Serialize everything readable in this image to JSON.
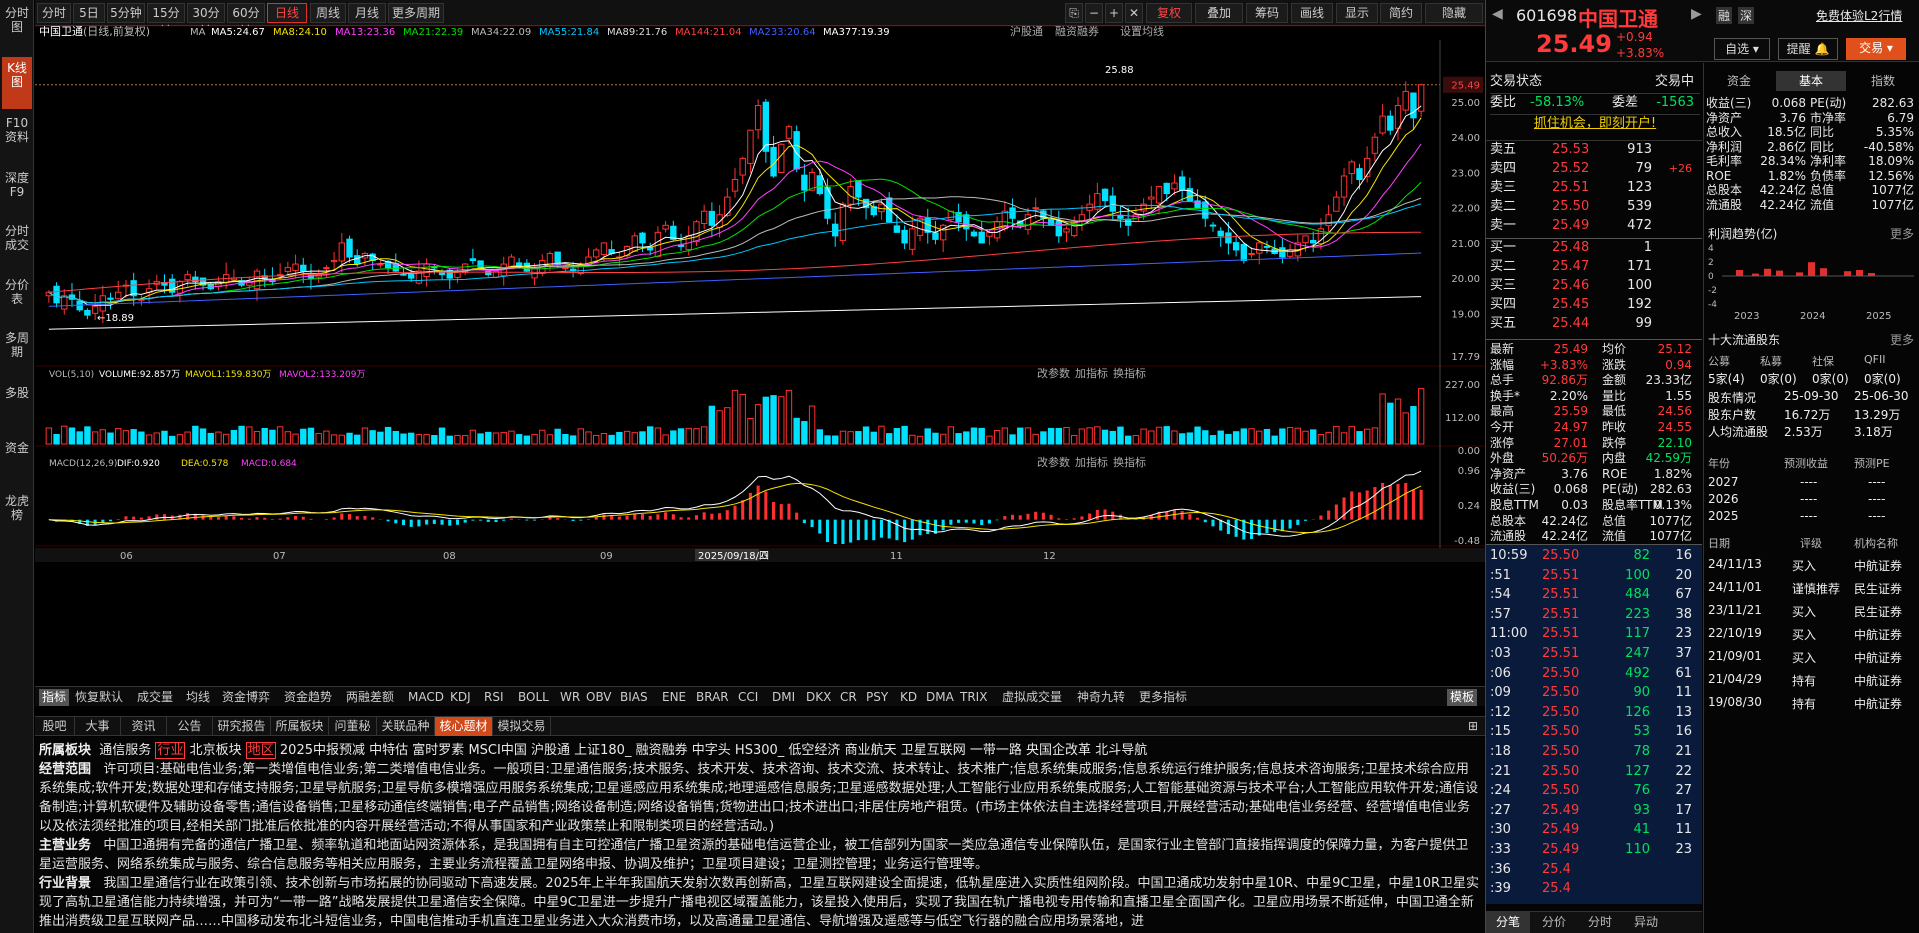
{
  "sidebar": [
    "分时图",
    "K线图",
    "F10资料",
    "深度F9",
    "分时成交",
    "分价表",
    "多周期",
    "多股",
    "资金",
    "龙虎榜"
  ],
  "toolbar": {
    "periods": [
      "分时",
      "5日",
      "5分钟",
      "15分钟",
      "30分钟",
      "60分钟",
      "日线",
      "周线",
      "月线",
      "更多周期"
    ],
    "right": [
      "复权",
      "叠加",
      "筹码",
      "画线",
      "显示",
      "简约",
      "隐藏"
    ]
  },
  "title": {
    "name": "中国卫通",
    "mode": "(日线,前复权)",
    "ma": "MA",
    "ma_items": [
      {
        "t": "MA5:24.67",
        "c": "#ffffff"
      },
      {
        "t": "MA8:24.10",
        "c": "#f5e400"
      },
      {
        "t": "MA13:23.36",
        "c": "#ff40ff"
      },
      {
        "t": "MA21:22.39",
        "c": "#00e000"
      },
      {
        "t": "MA34:22.09",
        "c": "#bbbbbb"
      },
      {
        "t": "MA55:21.84",
        "c": "#00c8ff"
      },
      {
        "t": "MA89:21.76",
        "c": "#dddddd"
      },
      {
        "t": "MA144:21.04",
        "c": "#ff4040"
      },
      {
        "t": "MA233:20.64",
        "c": "#4060ff"
      },
      {
        "t": "MA377:19.39",
        "c": "#ffffff"
      }
    ],
    "links": [
      "沪股通",
      "融资融券",
      "设置均线"
    ]
  },
  "price_axis": [
    "25.49",
    "25.00",
    "24.00",
    "23.00",
    "22.00",
    "21.00",
    "20.00",
    "19.00",
    "17.79"
  ],
  "annot": {
    "high": "25.88",
    "low": "18.89"
  },
  "vol": {
    "title": "VOL(5,10)",
    "v": "VOLUME:92.857万",
    "m1": "MAVOL1:159.830万",
    "m2": "MAVOL2:133.209万",
    "axis": [
      "227.00",
      "112.00",
      "0.00"
    ],
    "links": [
      "改参数",
      "加指标",
      "换指标"
    ]
  },
  "macd": {
    "title": "MACD(12,26,9)",
    "dif": "DIF:0.920",
    "dea": "DEA:0.578",
    "macd": "MACD:0.684",
    "axis": [
      "0.96",
      "0.24",
      "-0.48"
    ],
    "links": [
      "改参数",
      "加指标",
      "换指标"
    ]
  },
  "xaxis": [
    "06",
    "07",
    "08",
    "09",
    "10",
    "11",
    "12"
  ],
  "cursor_date": "2025/09/18/四",
  "indicators": [
    "指标",
    "恢复默认",
    "成交量",
    "均线",
    "资金博弈",
    "资金趋势",
    "两融差额",
    "MACD",
    "KDJ",
    "RSI",
    "BOLL",
    "WR",
    "OBV",
    "BIAS",
    "ENE",
    "BRAR",
    "CCI",
    "DMI",
    "DKX",
    "CR",
    "PSY",
    "KD",
    "DMA",
    "TRIX",
    "虚拟成交量",
    "神奇九转",
    "更多指标",
    "模板"
  ],
  "btabs": [
    "股吧",
    "大事",
    "资讯",
    "公告",
    "研究报告",
    "所属板块",
    "问董秘",
    "关联品种",
    "核心题材",
    "模拟交易"
  ],
  "info": {
    "bk_label": "所属板块",
    "bk": [
      "通信服务",
      "行业",
      "北京板块",
      "地区",
      "2025中报预减",
      "中特估",
      "富时罗素",
      "MSCI中国",
      "沪股通",
      "上证180_",
      "融资融券",
      "中字头",
      "HS300_",
      "低空经济",
      "商业航天",
      "卫星互联网",
      "一带一路",
      "央国企改革",
      "北斗导航"
    ],
    "scope_label": "经营范围",
    "scope": "许可项目:基础电信业务;第一类增值电信业务;第二类增值电信业务。一般项目:卫星通信服务;技术服务、技术开发、技术咨询、技术交流、技术转让、技术推广;信息系统集成服务;信息系统运行维护服务;信息技术咨询服务;卫星技术综合应用系统集成;软件开发;数据处理和存储支持服务;卫星导航服务;卫星导航多模增强应用服务系统集成;卫星遥感应用系统集成;地理遥感信息服务;卫星遥感数据处理;人工智能行业应用系统集成服务;人工智能基础资源与技术平台;人工智能应用软件开发;通信设备制造;计算机软硬件及辅助设备零售;通信设备销售;卫星移动通信终端销售;电子产品销售;网络设备制造;网络设备销售;货物进出口;技术进出口;非居住房地产租赁。(市场主体依法自主选择经营项目,开展经营活动;基础电信业务经营、经营增值电信业务以及依法须经批准的项目,经相关部门批准后依批准的内容开展经营活动;不得从事国家和产业政策禁止和限制类项目的经营活动。)",
    "main_label": "主营业务",
    "main": "中国卫通拥有完备的通信广播卫星、频率轨道和地面站网资源体系，是我国拥有自主可控通信广播卫星资源的基础电信运营企业，被工信部列为国家一类应急通信专业保障队伍，是国家行业主管部门直接指挥调度的保障力量，为客户提供卫星运营服务、网络系统集成与服务、综合信息服务等相关应用服务，主要业务流程覆盖卫星网络申报、协调及维护；卫星项目建设；卫星测控管理；业务运行管理等。",
    "bg_label": "行业背景",
    "bg": "我国卫星通信行业在政策引领、技术创新与市场拓展的协同驱动下高速发展。2025年上半年我国航天发射次数再创新高，卫星互联网建设全面提速，低轨星座进入实质性组网阶段。中国卫通成功发射中星10R、中星9C卫星，中星10R卫星实现了高轨卫星通信能力持续增强，并可为“一带一路”战略发展提供卫星通信安全保障。中星9C卫星进一步提升广播电视区域覆盖能力，该星投入使用后，实现了我国在轨广播电视专用传输和直播卫星全面国产化。卫星应用场景不断延伸，中国卫通全新推出消费级卫星互联网产品……中国移动发布北斗短信业务，中国电信推动手机直连卫星业务进入大众消费市场，以及高通量卫星通信、导航增强及遥感等与低空飞行器的融合应用场景落地，进"
  },
  "rp": {
    "code": "601698",
    "name": "中国卫通",
    "badges": [
      "融",
      "深"
    ],
    "free": "免费体验L2行情",
    "price": "25.49",
    "chg": "+0.94",
    "pct": "+3.83%",
    "btn1": "自选",
    "btn2": "提醒",
    "btn3": "交易",
    "status": "交易状态",
    "status_val": "交易中",
    "wb": "委比",
    "wb_v": "-58.13%",
    "wc": "委差",
    "wc_v": "-1563",
    "promo": "抓住机会，即刻开户!",
    "asks": [
      {
        "l": "卖五",
        "p": "25.53",
        "v": "913",
        "x": ""
      },
      {
        "l": "卖四",
        "p": "25.52",
        "v": "79",
        "x": "+26"
      },
      {
        "l": "卖三",
        "p": "25.51",
        "v": "123",
        "x": ""
      },
      {
        "l": "卖二",
        "p": "25.50",
        "v": "539",
        "x": ""
      },
      {
        "l": "卖一",
        "p": "25.49",
        "v": "472",
        "x": ""
      }
    ],
    "bids": [
      {
        "l": "买一",
        "p": "25.48",
        "v": "1"
      },
      {
        "l": "买二",
        "p": "25.47",
        "v": "171"
      },
      {
        "l": "买三",
        "p": "25.46",
        "v": "100"
      },
      {
        "l": "买四",
        "p": "25.45",
        "v": "192"
      },
      {
        "l": "买五",
        "p": "25.44",
        "v": "99"
      }
    ],
    "stats": [
      [
        "最新",
        "25.49",
        "均价",
        "25.12"
      ],
      [
        "涨幅",
        "+3.83%",
        "涨跌",
        "0.94"
      ],
      [
        "总手",
        "92.86万",
        "金额",
        "23.33亿"
      ],
      [
        "换手*",
        "2.20%",
        "量比",
        "1.55"
      ],
      [
        "最高",
        "25.59",
        "最低",
        "24.56"
      ],
      [
        "今开",
        "24.97",
        "昨收",
        "24.55"
      ],
      [
        "涨停",
        "27.01",
        "跌停",
        "22.10"
      ],
      [
        "外盘",
        "50.26万",
        "内盘",
        "42.59万"
      ],
      [
        "净资产",
        "3.76",
        "ROE",
        "1.82%"
      ],
      [
        "收益(三)",
        "0.068",
        "PE(动)",
        "282.63"
      ],
      [
        "股息TTM",
        "0.03",
        "股息率TTM",
        "0.13%"
      ],
      [
        "总股本",
        "42.24亿",
        "总值",
        "1077亿"
      ],
      [
        "流通股",
        "42.24亿",
        "流值",
        "1077亿"
      ]
    ],
    "ticks": [
      [
        "10:59",
        "25.50",
        "82",
        "16"
      ],
      [
        ":51",
        "25.51",
        "100",
        "20"
      ],
      [
        ":54",
        "25.51",
        "484",
        "67"
      ],
      [
        ":57",
        "25.51",
        "223",
        "38"
      ],
      [
        "11:00",
        "25.51",
        "117",
        "23"
      ],
      [
        ":03",
        "25.51",
        "247",
        "37"
      ],
      [
        ":06",
        "25.50",
        "492",
        "61"
      ],
      [
        ":09",
        "25.50",
        "90",
        "11"
      ],
      [
        ":12",
        "25.50",
        "126",
        "13"
      ],
      [
        ":15",
        "25.50",
        "53",
        "16"
      ],
      [
        ":18",
        "25.50",
        "78",
        "21"
      ],
      [
        ":21",
        "25.50",
        "127",
        "22"
      ],
      [
        ":24",
        "25.50",
        "76",
        "27"
      ],
      [
        ":27",
        "25.49",
        "93",
        "17"
      ],
      [
        ":30",
        "25.49",
        "41",
        "11"
      ],
      [
        ":33",
        "25.49",
        "110",
        "23"
      ],
      [
        ":36",
        "25.4",
        "",
        " "
      ],
      [
        ":39",
        "25.4",
        "",
        ""
      ]
    ],
    "ftabs": [
      "分笔",
      "分价",
      "分时",
      "异动"
    ],
    "f10tabs": [
      "资金",
      "基本",
      "指数"
    ],
    "basic": [
      [
        "收益(三)",
        "0.068",
        "PE(动)",
        "282.63"
      ],
      [
        "净资产",
        "3.76",
        "市净率",
        "6.79"
      ],
      [
        "总收入",
        "18.5亿",
        "同比",
        "5.35%"
      ],
      [
        "净利润",
        "2.86亿",
        "同比",
        "-40.58%"
      ],
      [
        "毛利率",
        "28.34%",
        "净利率",
        "18.09%"
      ],
      [
        "ROE",
        "1.82%",
        "负债率",
        "12.56%"
      ],
      [
        "总股本",
        "42.24亿",
        "总值",
        "1077亿"
      ],
      [
        "流通股",
        "42.24亿",
        "流值",
        "1077亿"
      ]
    ],
    "profit_title": "利润趋势(亿)",
    "more": "更多",
    "profit_y": [
      "4",
      "2",
      "0",
      "-2",
      "-4"
    ],
    "profit_x": [
      "2023",
      "2024",
      "2025"
    ],
    "holders_title": "十大流通股东",
    "holders_cols": [
      "公募",
      "私募",
      "社保",
      "QFII"
    ],
    "holders_vals": [
      "5家(4)",
      "0家(0)",
      "0家(0)",
      "0家(0)"
    ],
    "holders_rows": [
      [
        "股东情况",
        "25-09-30",
        "25-06-30"
      ],
      [
        "股东户数",
        "16.72万",
        "13.29万"
      ],
      [
        "人均流通股",
        "2.53万",
        "3.18万"
      ]
    ],
    "est_cols": [
      "年份",
      "预测收益",
      "预测PE"
    ],
    "est_rows": [
      [
        "2027",
        "----",
        "----"
      ],
      [
        "2026",
        "----",
        "----"
      ],
      [
        "2025",
        "----",
        "----"
      ]
    ],
    "rating_cols": [
      "日期",
      "评级",
      "机构名称"
    ],
    "ratings": [
      [
        "24/11/13",
        "买入",
        "中航证券"
      ],
      [
        "24/11/01",
        "谨慎推荐",
        "民生证券"
      ],
      [
        "23/11/21",
        "买入",
        "民生证券"
      ],
      [
        "22/10/19",
        "买入",
        "中航证券"
      ],
      [
        "21/09/01",
        "买入",
        "中航证券"
      ],
      [
        "21/04/29",
        "持有",
        "中航证券"
      ],
      [
        "19/08/30",
        "持有",
        "中航证券"
      ]
    ]
  },
  "chart_data": {
    "type": "candlestick",
    "title": "中国卫通",
    "price_range": [
      17.79,
      25.88
    ],
    "high": 25.88,
    "low": 18.89,
    "last": 25.49,
    "months": [
      "06",
      "07",
      "08",
      "09",
      "10",
      "11",
      "12"
    ],
    "close": [
      19.6,
      19.3,
      19.5,
      19.4,
      19.1,
      18.95,
      19.2,
      19.5,
      19.4,
      19.6,
      19.8,
      19.5,
      19.4,
      19.7,
      19.9,
      19.8,
      19.6,
      19.9,
      20.1,
      19.9,
      19.8,
      19.7,
      19.9,
      20.1,
      20.0,
      19.8,
      19.9,
      20.2,
      20.0,
      19.9,
      20.1,
      20.3,
      20.4,
      20.2,
      20.0,
      20.1,
      20.3,
      20.5,
      21.0,
      20.6,
      20.4,
      20.7,
      20.5,
      20.4,
      20.3,
      20.2,
      20.1,
      20.0,
      20.2,
      20.4,
      20.3,
      20.1,
      20.0,
      20.2,
      20.4,
      20.5,
      20.3,
      20.1,
      20.2,
      20.4,
      20.6,
      20.3,
      20.2,
      20.3,
      20.5,
      20.7,
      20.4,
      20.3,
      20.2,
      20.4,
      20.6,
      20.8,
      21.0,
      20.7,
      20.6,
      20.9,
      21.2,
      21.0,
      20.8,
      21.3,
      21.5,
      21.1,
      20.9,
      21.2,
      21.6,
      21.9,
      21.5,
      21.8,
      22.3,
      22.8,
      23.4,
      24.2,
      24.9,
      23.6,
      22.9,
      23.8,
      24.3,
      23.1,
      22.5,
      23.0,
      22.4,
      21.7,
      21.2,
      22.1,
      22.6,
      22.3,
      22.0,
      21.8,
      22.1,
      21.6,
      21.3,
      21.0,
      21.4,
      21.7,
      21.3,
      21.1,
      21.5,
      21.9,
      21.6,
      21.4,
      21.2,
      21.0,
      21.3,
      21.6,
      21.9,
      21.7,
      21.5,
      21.8,
      22.0,
      21.7,
      21.5,
      21.2,
      21.4,
      21.6,
      21.8,
      22.1,
      22.4,
      22.2,
      21.9,
      21.7,
      21.5,
      21.8,
      22.1,
      22.3,
      22.6,
      22.4,
      22.7,
      22.5,
      22.2,
      22.0,
      21.7,
      21.5,
      21.2,
      21.0,
      20.8,
      20.5,
      20.7,
      21.0,
      20.9,
      20.7,
      20.6,
      20.8,
      21.0,
      21.2,
      21.0,
      21.4,
      21.8,
      22.3,
      22.9,
      23.3,
      22.8,
      23.4,
      24.0,
      24.6,
      24.2,
      24.9,
      25.3,
      24.55,
      25.49
    ],
    "volume_range": [
      0,
      227
    ],
    "macd_range": [
      -0.48,
      0.96
    ]
  }
}
